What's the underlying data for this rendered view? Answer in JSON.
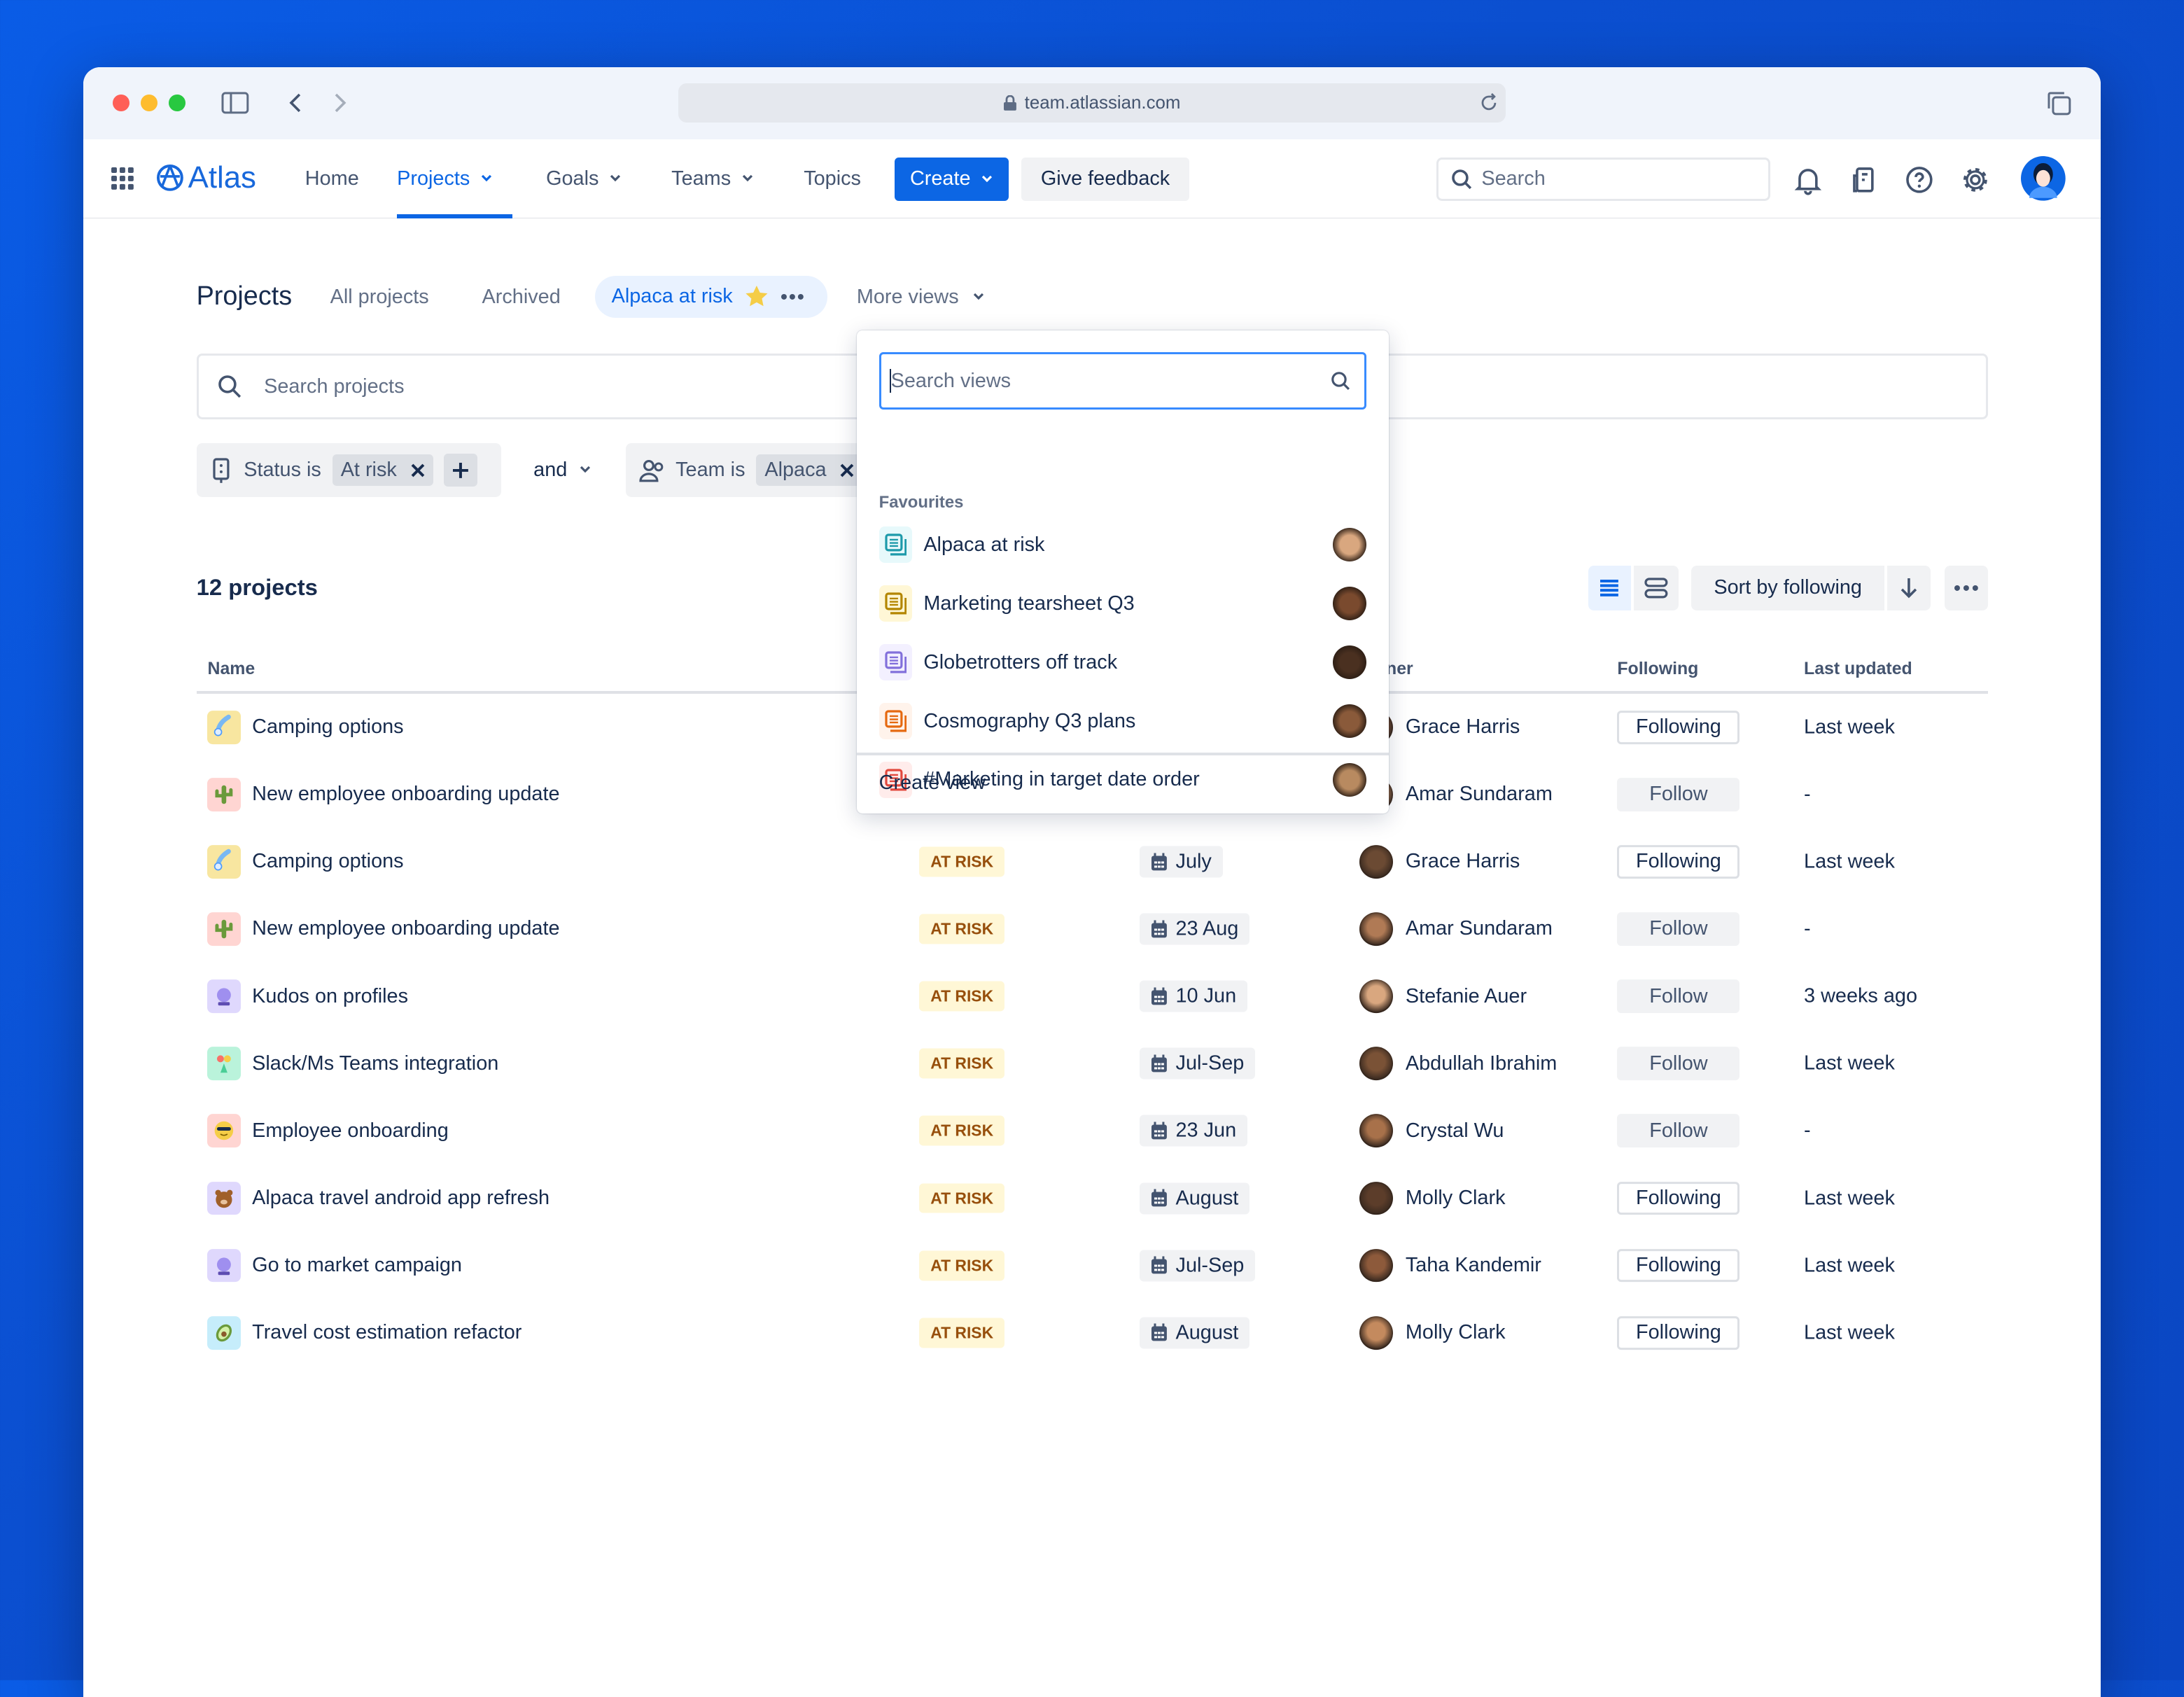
{
  "browser": {
    "url": "team.atlassian.com"
  },
  "nav": {
    "logo": "Atlas",
    "items": [
      {
        "label": "Home",
        "dropdown": false,
        "active": false
      },
      {
        "label": "Projects",
        "dropdown": true,
        "active": true
      },
      {
        "label": "Goals",
        "dropdown": true,
        "active": false
      },
      {
        "label": "Teams",
        "dropdown": true,
        "active": false
      },
      {
        "label": "Topics",
        "dropdown": false,
        "active": false
      }
    ],
    "create_label": "Create",
    "feedback_label": "Give feedback",
    "search_placeholder": "Search"
  },
  "page": {
    "title": "Projects",
    "tabs": [
      "All projects",
      "Archived"
    ],
    "active_view": "Alpaca at risk",
    "more_views": "More views",
    "search_placeholder": "Search projects",
    "filters": {
      "status_label": "Status is",
      "status_value": "At risk",
      "conjunction": "and",
      "team_label": "Team is",
      "team_value": "Alpaca"
    },
    "count": "12 projects",
    "sort_label": "Sort by following"
  },
  "table": {
    "headers": {
      "name": "Name",
      "owner": "ner",
      "following": "Following",
      "last_updated": "Last updated"
    },
    "rows": [
      {
        "name": "Camping options",
        "icon": "comet",
        "status": "",
        "date": "",
        "owner": "Grace Harris",
        "following": "Following",
        "updated": "Last week"
      },
      {
        "name": "New employee onboarding update",
        "icon": "cactus",
        "status": "",
        "date": "",
        "owner": "Amar Sundaram",
        "following": "Follow",
        "updated": "-"
      },
      {
        "name": "Camping options",
        "icon": "comet",
        "status": "AT RISK",
        "date": "July",
        "owner": "Grace Harris",
        "following": "Following",
        "updated": "Last week"
      },
      {
        "name": "New employee onboarding update",
        "icon": "cactus",
        "status": "AT RISK",
        "date": "23 Aug",
        "owner": "Amar Sundaram",
        "following": "Follow",
        "updated": "-"
      },
      {
        "name": "Kudos on profiles",
        "icon": "crystal-ball",
        "status": "AT RISK",
        "date": "10 Jun",
        "owner": "Stefanie Auer",
        "following": "Follow",
        "updated": "3 weeks ago"
      },
      {
        "name": "Slack/Ms Teams integration",
        "icon": "bouquet",
        "status": "AT RISK",
        "date": "Jul-Sep",
        "owner": "Abdullah Ibrahim",
        "following": "Follow",
        "updated": "Last week"
      },
      {
        "name": "Employee onboarding",
        "icon": "sunglasses-face",
        "status": "AT RISK",
        "date": "23 Jun",
        "owner": "Crystal Wu",
        "following": "Follow",
        "updated": "-"
      },
      {
        "name": "Alpaca travel android app refresh",
        "icon": "bear",
        "status": "AT RISK",
        "date": "August",
        "owner": "Molly Clark",
        "following": "Following",
        "updated": "Last week"
      },
      {
        "name": "Go to market campaign",
        "icon": "crystal-ball",
        "status": "AT RISK",
        "date": "Jul-Sep",
        "owner": "Taha Kandemir",
        "following": "Following",
        "updated": "Last week"
      },
      {
        "name": "Travel cost estimation refactor",
        "icon": "avocado",
        "status": "AT RISK",
        "date": "August",
        "owner": "Molly Clark",
        "following": "Following",
        "updated": "Last week"
      }
    ]
  },
  "views_dropdown": {
    "search_placeholder": "Search views",
    "section": "Favourites",
    "items": [
      {
        "label": "Alpaca at risk",
        "color": "#1d9aaa",
        "bg": "#e7f9fb"
      },
      {
        "label": "Marketing tearsheet Q3",
        "color": "#b38600",
        "bg": "#fff7d6"
      },
      {
        "label": "Globetrotters off track",
        "color": "#8270db",
        "bg": "#f3f0ff"
      },
      {
        "label": "Cosmography Q3 plans",
        "color": "#e56910",
        "bg": "#fff3eb"
      },
      {
        "label": "#Marketing in target date order",
        "color": "#e2483d",
        "bg": "#ffeceb"
      }
    ],
    "create_label": "Create view"
  },
  "colors": {
    "accent": "#0c66e4",
    "at_risk_bg": "#fff7d6",
    "at_risk_text": "#974f0c"
  }
}
